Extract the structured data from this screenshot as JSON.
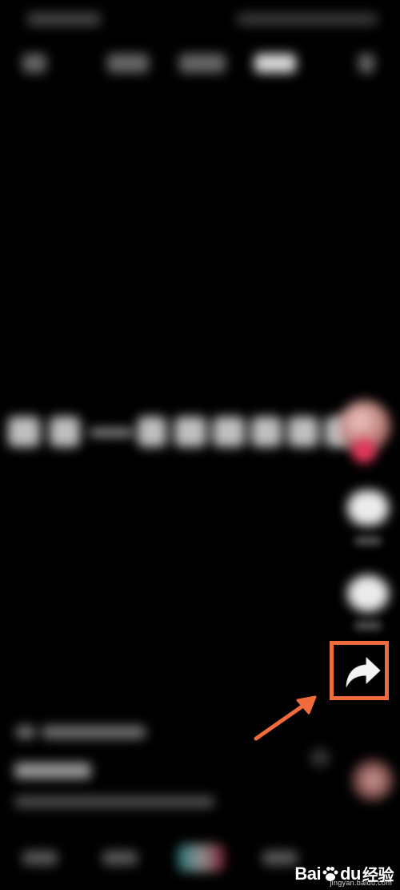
{
  "watermark": {
    "brand_left": "Bai",
    "brand_right": "du",
    "brand_suffix": "经验",
    "url": "jingyan.baidu.com"
  },
  "colors": {
    "highlight": "#f06b3c",
    "background": "#000000",
    "accent_pink": "#e8365e"
  },
  "icons": {
    "share": "share-arrow-icon",
    "like": "heart-icon",
    "comment": "comment-icon",
    "avatar": "avatar",
    "music": "music-disc-icon"
  }
}
